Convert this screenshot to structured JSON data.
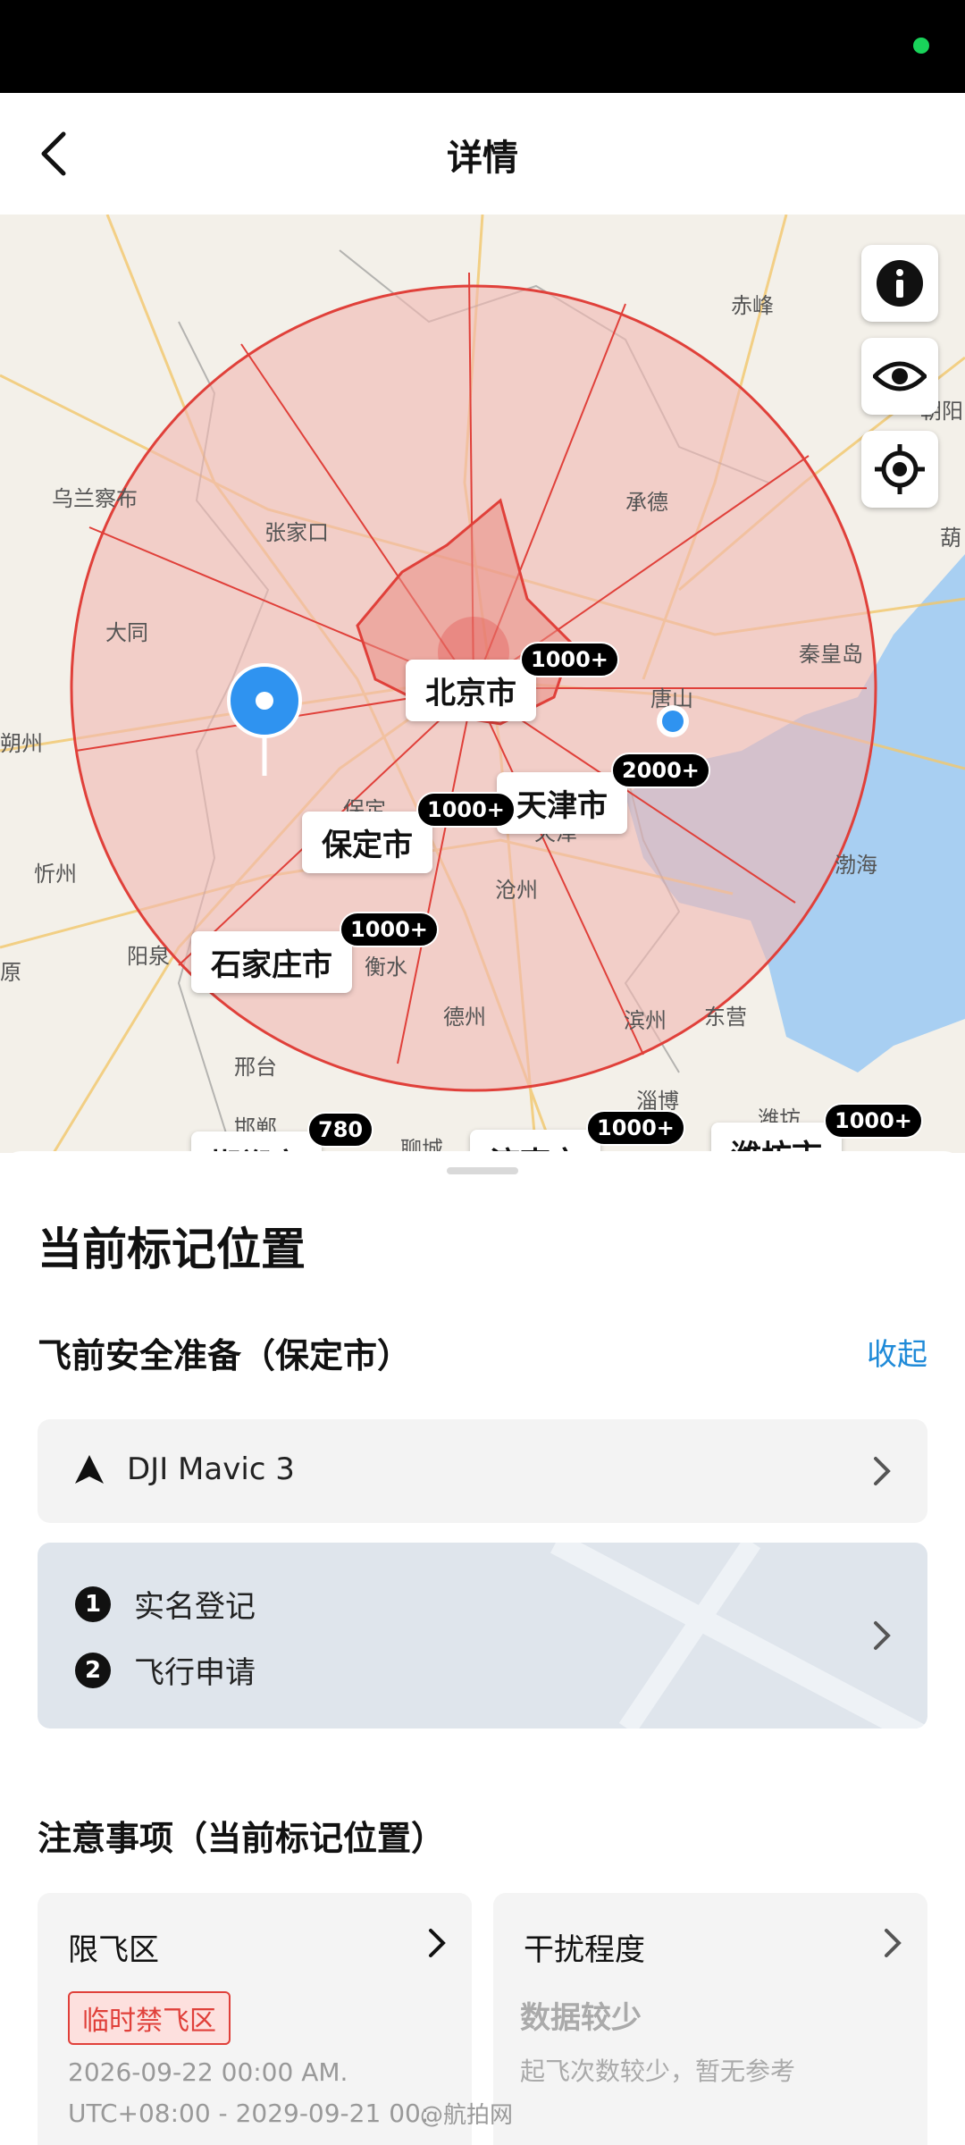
{
  "header": {
    "title": "详情"
  },
  "map": {
    "places": {
      "chifeng": "赤峰",
      "chaoyang": "朝阳",
      "hulu": "葫",
      "ulanqab": "乌兰察布",
      "zhangjiakou": "张家口",
      "chengde": "承德",
      "datong": "大同",
      "qinhuangdao": "秦皇岛",
      "tangshan": "唐山",
      "shuozhou": "朔州",
      "xinzhou": "忻州",
      "cangzhou": "沧州",
      "bohai": "渤海",
      "yangquan": "阳泉",
      "taiyuan": "原",
      "hengshui": "衡水",
      "dezhou": "德州",
      "binzhou": "滨州",
      "dongying": "东营",
      "xingtai": "邢台",
      "zibo": "淄博",
      "handan": "邯郸",
      "liaocheng": "聊城",
      "weifang_small": "潍坊",
      "baoding_small": "保定",
      "tianjin_small": "天津"
    },
    "cities": [
      {
        "name": "北京市",
        "count": "1000+"
      },
      {
        "name": "天津市",
        "count": "2000+"
      },
      {
        "name": "保定市",
        "count": "1000+"
      },
      {
        "name": "石家庄市",
        "count": "1000+"
      },
      {
        "name": "邯郸市",
        "count": "780"
      },
      {
        "name": "济南市",
        "count": "1000+"
      },
      {
        "name": "潍坊市",
        "count": "1000+"
      }
    ]
  },
  "sheet": {
    "title": "当前标记位置",
    "prep_title": "飞前安全准备（保定市）",
    "collapse": "收起",
    "drone": "DJI Mavic 3",
    "steps": [
      {
        "num": "1",
        "label": "实名登记"
      },
      {
        "num": "2",
        "label": "飞行申请"
      }
    ],
    "notice_title": "注意事项（当前标记位置）",
    "notice": {
      "restricted": {
        "title": "限飞区",
        "tag": "临时禁飞区",
        "time_line1": "2026-09-22 00:00 AM.",
        "time_line2": "UTC+08:00 - 2029-09-21 00:"
      },
      "interference": {
        "title": "干扰程度",
        "level": "数据较少",
        "desc": "起飞次数较少，暂无参考"
      }
    },
    "watermark": "@航拍网"
  },
  "colors": {
    "accent": "#1f8ad8",
    "restricted": "#e0403a",
    "zone_fill": "#f2b8b2",
    "water": "#a8cff2"
  },
  "icons": [
    "back-icon",
    "info-icon",
    "eye-icon",
    "locate-icon",
    "navigation-arrow-icon",
    "chevron-right-icon",
    "map-pin-icon"
  ]
}
